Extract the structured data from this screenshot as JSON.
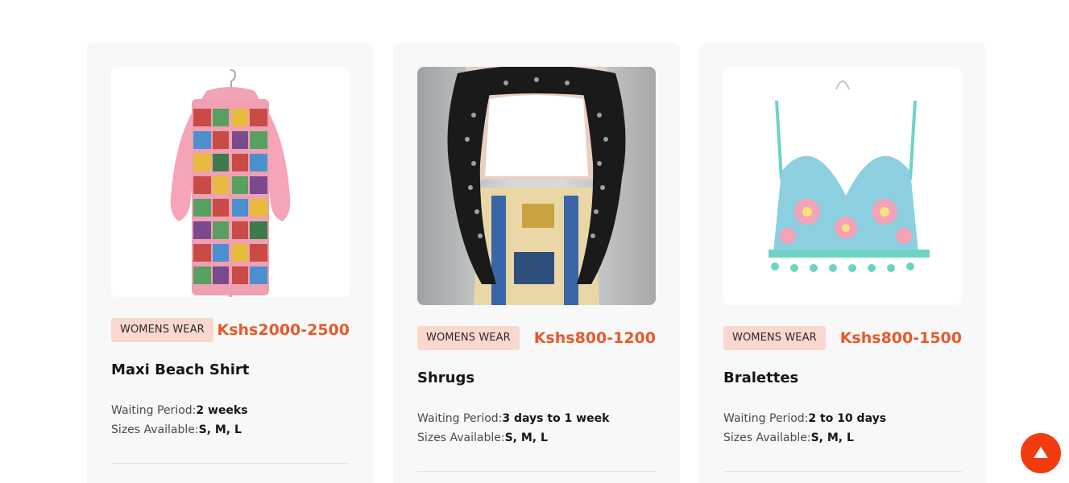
{
  "products": [
    {
      "image_alt": "Maxi Beach Shirt",
      "category": "WOMENS WEAR",
      "price": "Kshs2000-2500",
      "title": "Maxi Beach Shirt",
      "waiting_label": "Waiting Period:",
      "waiting_value": "2 weeks",
      "sizes_label": "Sizes Available:",
      "sizes_value": "S, M, L"
    },
    {
      "image_alt": "Shrugs",
      "category": "WOMENS WEAR",
      "price": "Kshs800-1200",
      "title": "Shrugs",
      "waiting_label": "Waiting Period:",
      "waiting_value": "3 days to 1 week",
      "sizes_label": "Sizes Available:",
      "sizes_value": "S, M, L"
    },
    {
      "image_alt": "Bralettes",
      "category": "WOMENS WEAR",
      "price": "Kshs800-1500",
      "title": "Bralettes",
      "waiting_label": "Waiting Period:",
      "waiting_value": "2 to 10 days",
      "sizes_label": "Sizes Available:",
      "sizes_value": "S, M, L"
    }
  ],
  "scroll_top": {
    "icon": "arrow-up-icon"
  },
  "colors": {
    "accent": "#e85a2b",
    "badge_bg": "#fbd8cf",
    "card_bg": "#f8f8f8",
    "scroll_button": "#f23b0f"
  }
}
